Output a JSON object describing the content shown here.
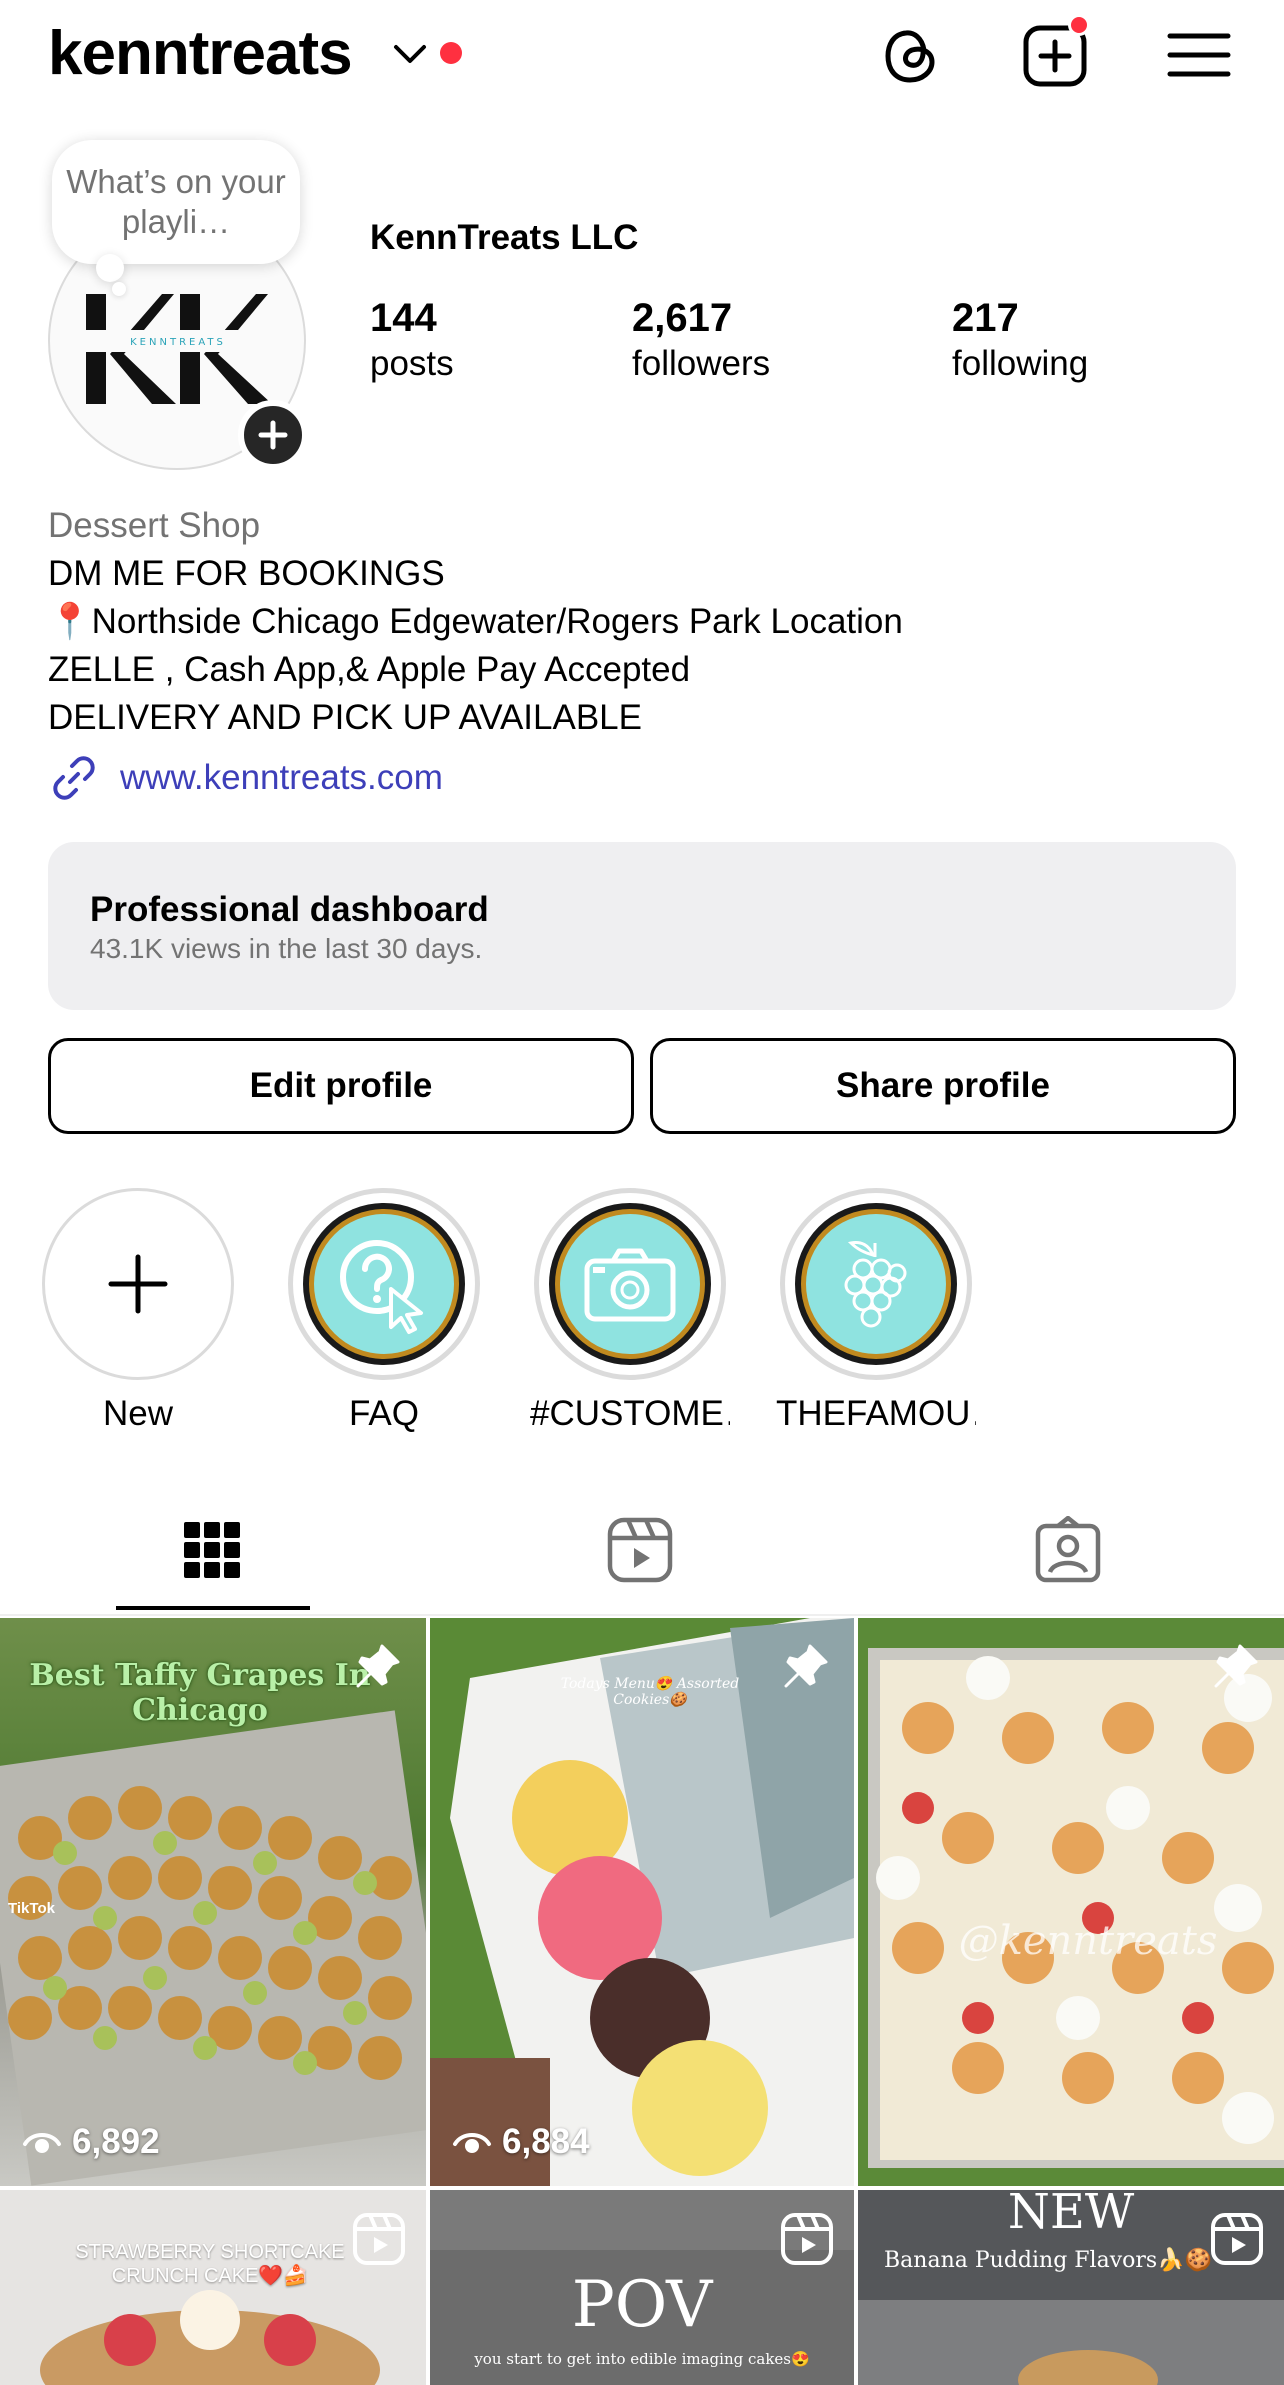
{
  "header": {
    "username": "kenntreats",
    "icons": [
      "chevron-down-icon",
      "threads-icon",
      "create-post-icon",
      "menu-icon"
    ],
    "notification_dot_color": "#ff3040"
  },
  "profile": {
    "note_text": "What’s on your playli…",
    "avatar_logo": "KK",
    "avatar_logo_sub": "KENNTREATS",
    "full_name": "KennTreats LLC",
    "stats": [
      {
        "value": "144",
        "label": "posts"
      },
      {
        "value": "2,617",
        "label": "followers"
      },
      {
        "value": "217",
        "label": "following"
      }
    ],
    "category": "Dessert Shop",
    "bio_lines": [
      "DM ME FOR BOOKINGS",
      "📍Northside Chicago Edgewater/Rogers Park Location",
      "ZELLE , Cash App,& Apple Pay Accepted",
      "DELIVERY AND PICK UP AVAILABLE"
    ],
    "website": "www.kenntreats.com",
    "link_color": "#3d3fb9"
  },
  "dashboard": {
    "title": "Professional dashboard",
    "subtitle": "43.1K views in the last 30 days."
  },
  "buttons": {
    "edit": "Edit profile",
    "share": "Share profile"
  },
  "highlights": [
    {
      "label": "New",
      "icon": "plus-icon"
    },
    {
      "label": "FAQ",
      "icon": "question-cursor-icon"
    },
    {
      "label": "#CUSTOME…",
      "icon": "camera-icon"
    },
    {
      "label": "THEFAMOU…",
      "icon": "grapes-icon"
    }
  ],
  "tabs": [
    {
      "name": "grid",
      "icon": "grid-icon",
      "active": true
    },
    {
      "name": "reels",
      "icon": "reels-icon",
      "active": false
    },
    {
      "name": "tagged",
      "icon": "tagged-icon",
      "active": false
    }
  ],
  "posts": [
    {
      "caption": "Best Taffy Grapes In Chicago",
      "views": "6,892",
      "pinned": true,
      "watermark": "TikTok"
    },
    {
      "caption": "Todays Menu😍 Assorted Cookies🍪",
      "views": "6,884",
      "pinned": true
    },
    {
      "caption": "@kenntreats",
      "views": "",
      "pinned": true
    },
    {
      "caption": "STRAWBERRY SHORTCAKE CRUNCH CAKE❤️🍰",
      "reel": true
    },
    {
      "caption": "POV",
      "subcaption": "you start to get into edible imaging cakes😍",
      "reel": true
    },
    {
      "caption": "NEW",
      "subcaption": "Banana Pudding Flavors🍌🍪",
      "reel": true
    }
  ]
}
